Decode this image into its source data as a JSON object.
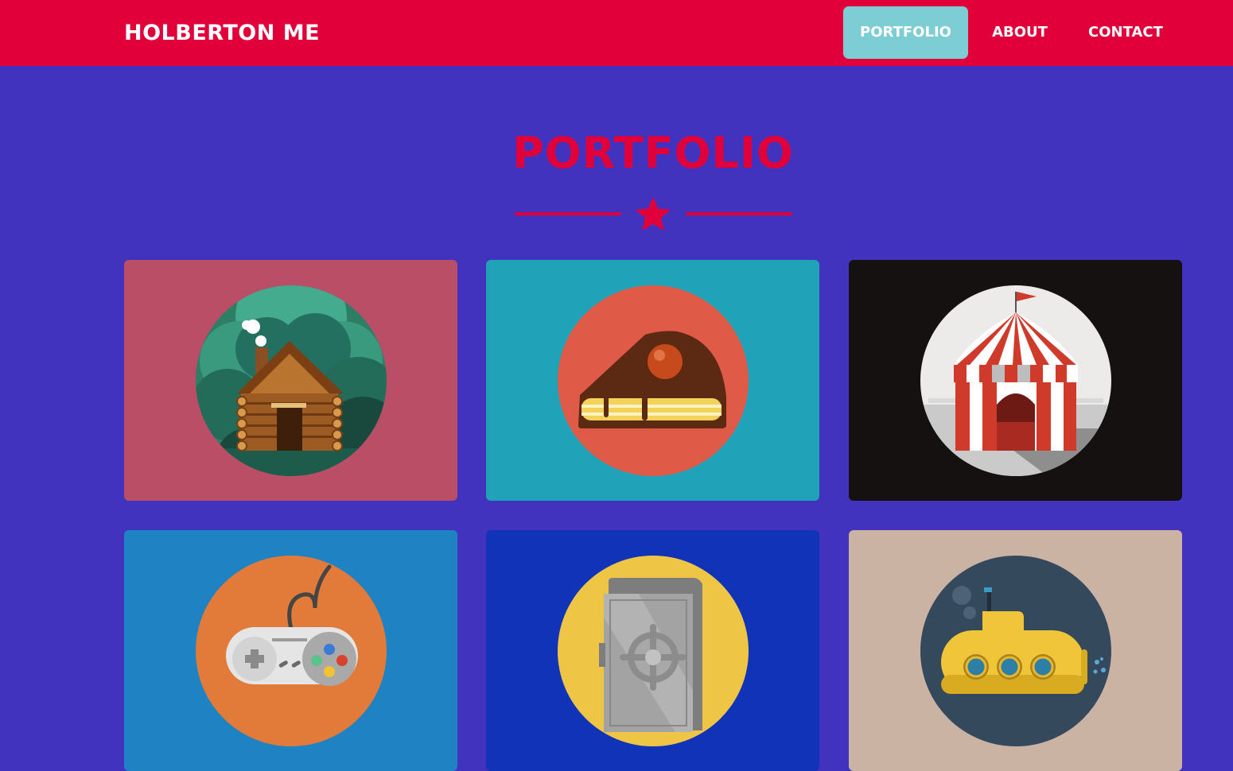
{
  "navbar": {
    "brand": "HOLBERTON ME",
    "links": [
      {
        "label": "PORTFOLIO",
        "active": true
      },
      {
        "label": "ABOUT",
        "active": false
      },
      {
        "label": "CONTACT",
        "active": false
      }
    ]
  },
  "portfolio": {
    "title": "PORTFOLIO",
    "divider_icon": "star-icon",
    "items": [
      {
        "icon": "cabin-icon",
        "background": "#b94e66",
        "circle": "#2e7e66"
      },
      {
        "icon": "cake-icon",
        "background": "#20a3b8",
        "circle": "#e05a48"
      },
      {
        "icon": "circus-tent-icon",
        "background": "#141110",
        "circle": "#ecebea"
      },
      {
        "icon": "game-controller-icon",
        "background": "#1e82c3",
        "circle": "#e27a3a"
      },
      {
        "icon": "safe-icon",
        "background": "#1033b8",
        "circle": "#eec545"
      },
      {
        "icon": "submarine-icon",
        "background": "#cbb3a4",
        "circle": "#35495c"
      }
    ]
  },
  "colors": {
    "page_background": "#4233bf",
    "navbar": "#e2003a",
    "active_link": "#7ccdd4",
    "title": "#e2003a"
  }
}
